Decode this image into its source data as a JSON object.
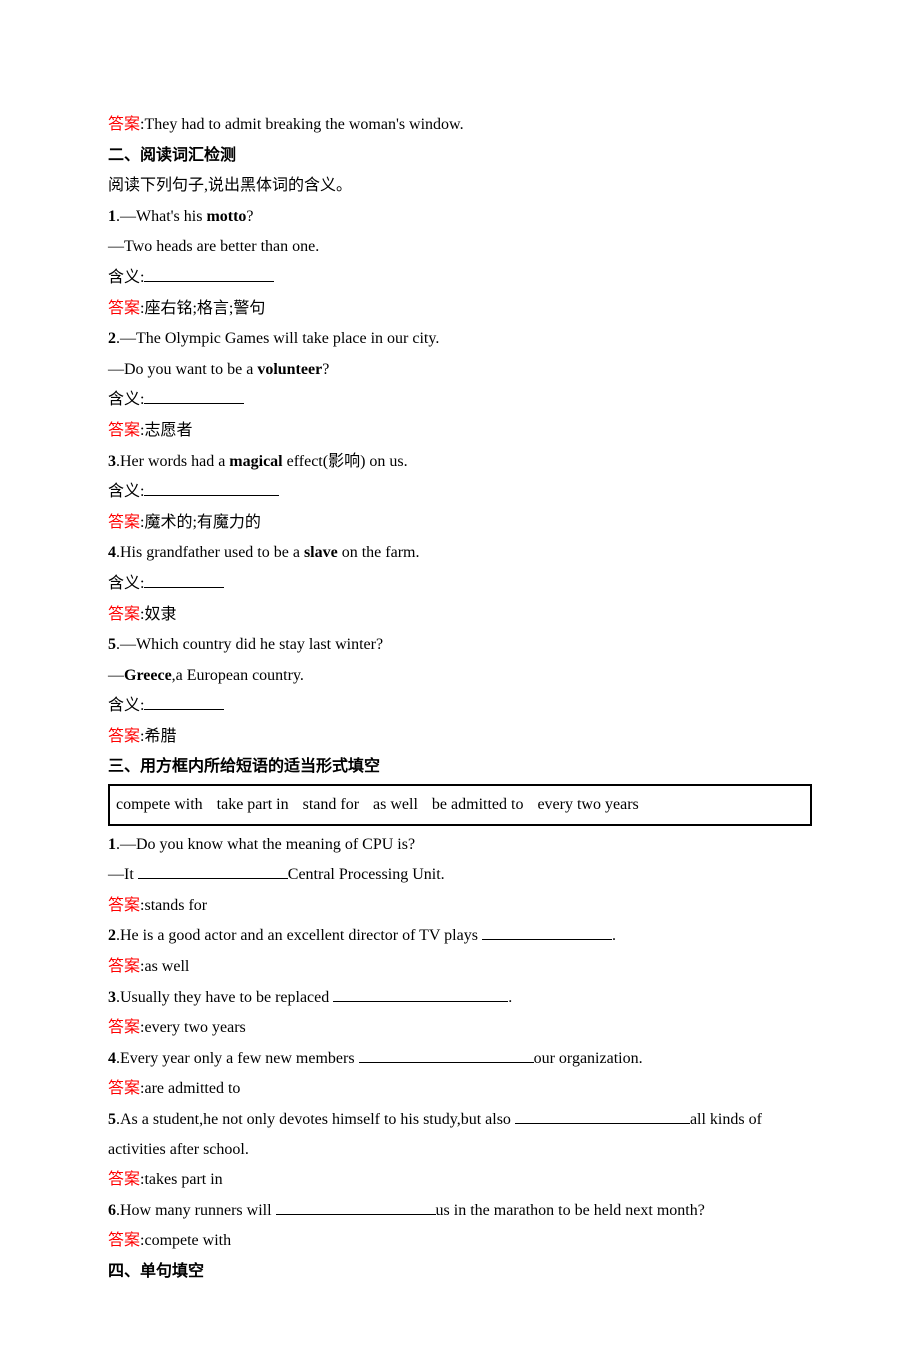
{
  "top": {
    "ans_label": "答案",
    "ans_text": ":They had to admit breaking the woman's window."
  },
  "s2": {
    "heading": "二、阅读词汇检测",
    "instr": "阅读下列句子,说出黑体词的含义。",
    "items": [
      {
        "num": "1",
        "q1a": ".—What's his ",
        "q1b": "motto",
        "q1c": "?",
        "q2": "—Two heads are better than one.",
        "meaning_label": "含义:",
        "blank_w": 130,
        "ans_label": "答案",
        "ans_text": ":座右铭;格言;警句"
      },
      {
        "num": "2",
        "q1a": ".—The Olympic Games will take place in our city.",
        "q1b": "",
        "q1c": "",
        "q2a": "—Do you want to be a ",
        "q2b": "volunteer",
        "q2c": "?",
        "meaning_label": "含义:",
        "blank_w": 100,
        "ans_label": "答案",
        "ans_text": ":志愿者"
      },
      {
        "num": "3",
        "q1a": ".Her words had a ",
        "q1b": "magical",
        "q1c": " effect(影响) on us.",
        "meaning_label": "含义:",
        "blank_w": 135,
        "ans_label": "答案",
        "ans_text": ":魔术的;有魔力的"
      },
      {
        "num": "4",
        "q1a": ".His grandfather used to be a ",
        "q1b": "slave",
        "q1c": " on the farm.",
        "meaning_label": "含义:",
        "blank_w": 80,
        "ans_label": "答案",
        "ans_text": ":奴隶"
      },
      {
        "num": "5",
        "q1a": ".—Which country did he stay last winter?",
        "q1b": "",
        "q1c": "",
        "q2a": "—",
        "q2b": "Greece",
        "q2c": ",a European country.",
        "meaning_label": "含义:",
        "blank_w": 80,
        "ans_label": "答案",
        "ans_text": ":希腊"
      }
    ]
  },
  "s3": {
    "heading": "三、用方框内所给短语的适当形式填空",
    "box": [
      "compete with",
      "take part in",
      "stand for",
      "as well",
      "be admitted to",
      "every two years"
    ],
    "items": [
      {
        "num": "1",
        "q1": ".—Do you know what the meaning of CPU is?",
        "q2a": "—It ",
        "blank_w": 150,
        "q2b": "Central Processing Unit.",
        "ans_label": "答案",
        "ans_text": ":stands for"
      },
      {
        "num": "2",
        "q1a": ".He is a good actor and an excellent director of TV plays ",
        "blank_w": 130,
        "q1b": ".",
        "ans_label": "答案",
        "ans_text": ":as well"
      },
      {
        "num": "3",
        "q1a": ".Usually they have to be replaced ",
        "blank_w": 175,
        "q1b": ".",
        "ans_label": "答案",
        "ans_text": ":every two years"
      },
      {
        "num": "4",
        "q1a": ".Every year only a few new members ",
        "blank_w": 175,
        "q1b": "our organization.",
        "ans_label": "答案",
        "ans_text": ":are admitted to"
      },
      {
        "num": "5",
        "q1a": ".As a student,he not only devotes himself to his study,but also ",
        "blank_w": 175,
        "q1b": "all kinds of activities after school.",
        "ans_label": "答案",
        "ans_text": ":takes part in"
      },
      {
        "num": "6",
        "q1a": ".How many runners will ",
        "blank_w": 160,
        "q1b": "us in the marathon to be held next month?",
        "ans_label": "答案",
        "ans_text": ":compete with"
      }
    ]
  },
  "s4": {
    "heading": "四、单句填空"
  }
}
